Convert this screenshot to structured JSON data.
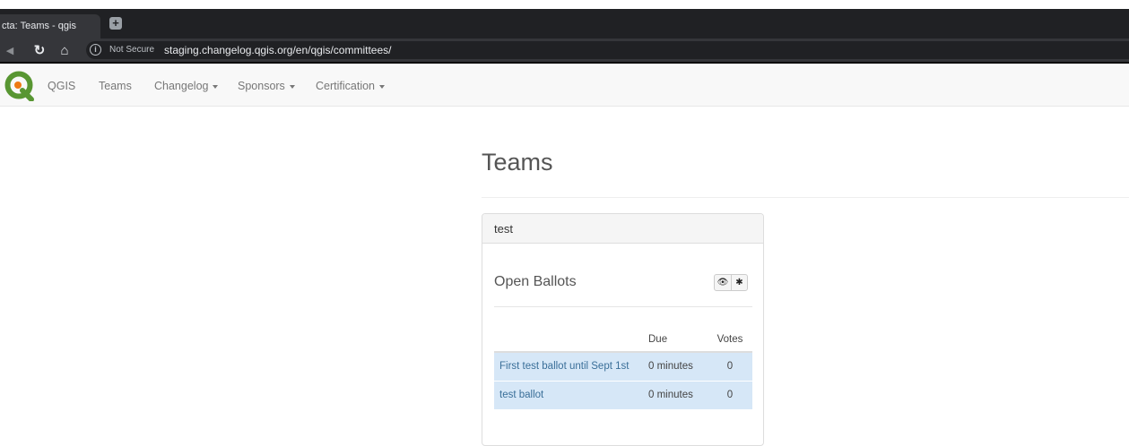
{
  "browser": {
    "tab_title": "cta: Teams - qgis",
    "new_tab_icon": "plus-icon",
    "not_secure": "Not Secure",
    "url": "staging.changelog.qgis.org/en/qgis/committees/"
  },
  "navbar": {
    "brand": "QGIS",
    "items": [
      {
        "label": "Teams"
      },
      {
        "label": "Changelog"
      },
      {
        "label": "Sponsors"
      },
      {
        "label": "Certification"
      }
    ]
  },
  "page": {
    "title": "Teams"
  },
  "team": {
    "name": "test",
    "section_title": "Open Ballots",
    "buttons": [
      {
        "icon": "eye-icon",
        "glyph": "👁"
      },
      {
        "icon": "asterisk-icon",
        "glyph": "✱"
      }
    ],
    "table": {
      "headers": [
        "",
        "Due",
        "Votes"
      ],
      "rows": [
        {
          "title": "First test ballot until Sept 1st",
          "due": "0 minutes",
          "votes": "0"
        },
        {
          "title": "test ballot",
          "due": "0 minutes",
          "votes": "0"
        }
      ]
    }
  },
  "colors": {
    "row_highlight": "#d6e7f7",
    "link": "#3a6f99",
    "navbar_bg": "#f8f8f8",
    "logo_green": "#589632",
    "logo_orange": "#ee7913"
  }
}
